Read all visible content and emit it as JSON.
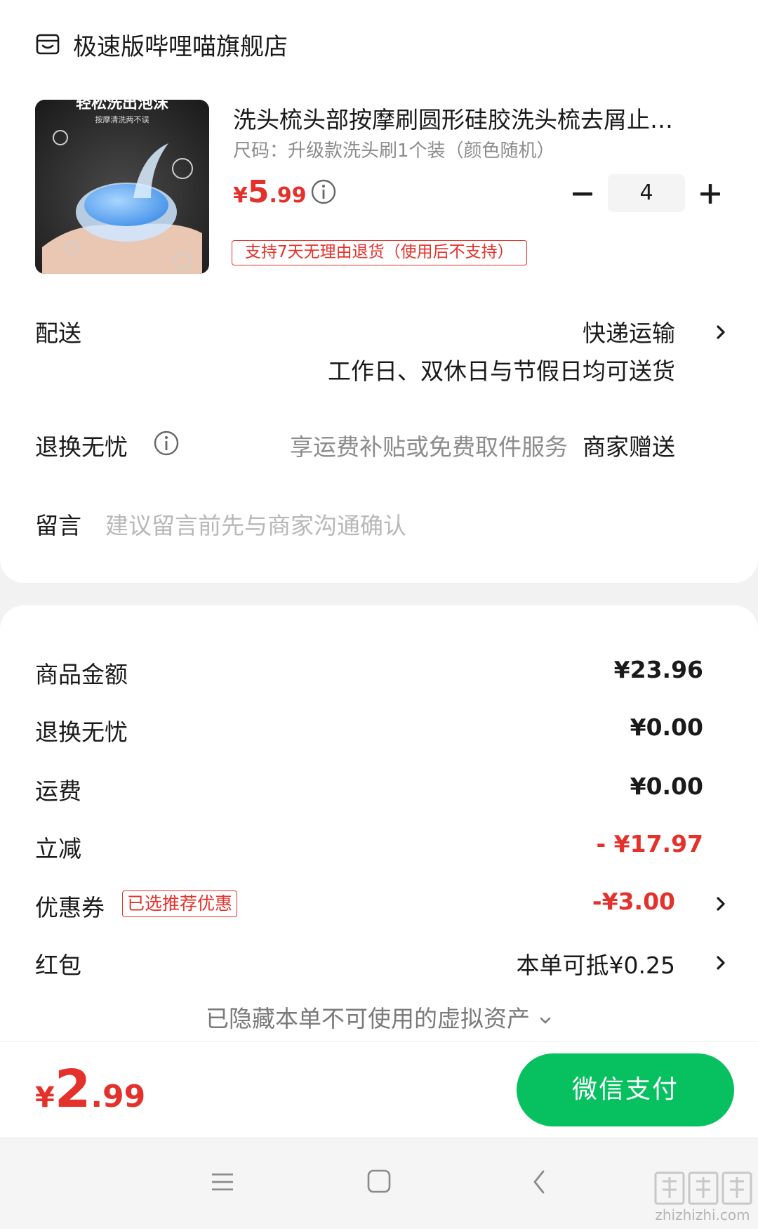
{
  "shop": {
    "name": "极速版哔哩喵旗舰店",
    "icon": "store-icon"
  },
  "product": {
    "image_caption": "轻松洗出泡沫",
    "image_subcaption": "按摩清洗两不误",
    "title": "洗头梳头部按摩刷圆形硅胶洗头梳去屑止…",
    "spec": "尺码：升级款洗头刷1个装（颜色随机）",
    "price_symbol": "¥",
    "price_int": "5",
    "price_dec": ".99",
    "quantity": "4",
    "return_policy": "支持7天无理由退货（使用后不支持）"
  },
  "delivery": {
    "label": "配送",
    "method": "快递运输",
    "note": "工作日、双休日与节假日均可送货"
  },
  "worry_free": {
    "label": "退换无忧",
    "desc": "享运费补贴或免费取件服务",
    "gift": "商家赠送"
  },
  "message": {
    "label": "留言",
    "placeholder": "建议留言前先与商家沟通确认"
  },
  "summary": {
    "goods_amount_label": "商品金额",
    "goods_amount_value": "¥23.96",
    "worry_free_label": "退换无忧",
    "worry_free_value": "¥0.00",
    "shipping_label": "运费",
    "shipping_value": "¥0.00",
    "discount_label": "立减",
    "discount_value": "- ¥17.97",
    "coupon_label": "优惠券",
    "coupon_tag": "已选推荐优惠",
    "coupon_value": "-¥3.00",
    "redpack_label": "红包",
    "redpack_value": "本单可抵¥0.25",
    "hidden_assets": "已隐藏本单不可使用的虚拟资产"
  },
  "total": {
    "symbol": "¥",
    "int": "2",
    "dec": ".99"
  },
  "pay_button": "微信支付",
  "watermark": "zhizhizhi.com",
  "colors": {
    "accent_red": "#e5312b",
    "wechat_green": "#07c160"
  }
}
